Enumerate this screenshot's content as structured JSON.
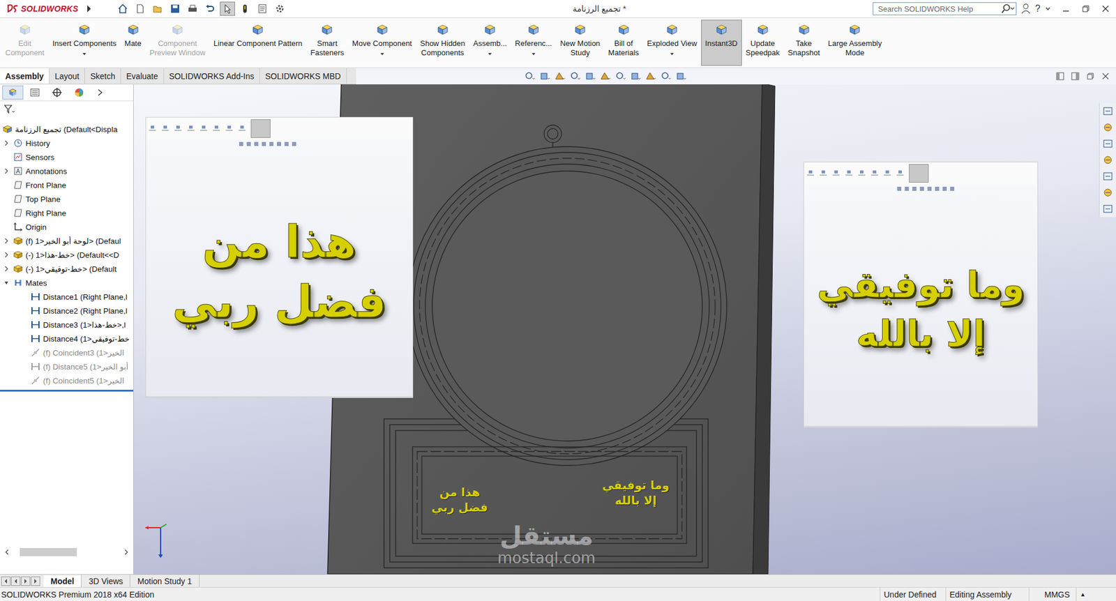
{
  "title_bar": {
    "logo": "SOLIDWORKS",
    "title": "تجميع الرزنامة *",
    "search": {
      "placeholder": "Search SOLIDWORKS Help"
    },
    "help": "?"
  },
  "ribbon": [
    {
      "lines": [
        "Edit",
        "Component"
      ],
      "disabled": true,
      "selected": false,
      "dropdown": false
    },
    {
      "lines": [
        "Insert Components"
      ],
      "disabled": false,
      "selected": false,
      "dropdown": true
    },
    {
      "lines": [
        "Mate"
      ],
      "disabled": false,
      "selected": false,
      "dropdown": false
    },
    {
      "lines": [
        "Component",
        "Preview Window"
      ],
      "disabled": true,
      "selected": false,
      "dropdown": false
    },
    {
      "lines": [
        "Linear Component Pattern"
      ],
      "disabled": false,
      "selected": false,
      "dropdown": false
    },
    {
      "lines": [
        "Smart",
        "Fasteners"
      ],
      "disabled": false,
      "selected": false,
      "dropdown": false
    },
    {
      "lines": [
        "Move Component"
      ],
      "disabled": false,
      "selected": false,
      "dropdown": true
    },
    {
      "lines": [
        "Show Hidden",
        "Components"
      ],
      "disabled": false,
      "selected": false,
      "dropdown": false
    },
    {
      "lines": [
        "Assemb..."
      ],
      "disabled": false,
      "selected": false,
      "dropdown": true
    },
    {
      "lines": [
        "Referenc..."
      ],
      "disabled": false,
      "selected": false,
      "dropdown": true
    },
    {
      "lines": [
        "New Motion",
        "Study"
      ],
      "disabled": false,
      "selected": false,
      "dropdown": false
    },
    {
      "lines": [
        "Bill of",
        "Materials"
      ],
      "disabled": false,
      "selected": false,
      "dropdown": false
    },
    {
      "lines": [
        "Exploded View"
      ],
      "disabled": false,
      "selected": false,
      "dropdown": true
    },
    {
      "lines": [
        "Instant3D"
      ],
      "disabled": false,
      "selected": true,
      "dropdown": false
    },
    {
      "lines": [
        "Update",
        "Speedpak"
      ],
      "disabled": false,
      "selected": false,
      "dropdown": false
    },
    {
      "lines": [
        "Take",
        "Snapshot"
      ],
      "disabled": false,
      "selected": false,
      "dropdown": false
    },
    {
      "lines": [
        "Large Assembly",
        "Mode"
      ],
      "disabled": false,
      "selected": false,
      "dropdown": false
    }
  ],
  "tabs": [
    {
      "label": "Assembly",
      "selected": true
    },
    {
      "label": "Layout",
      "selected": false
    },
    {
      "label": "Sketch",
      "selected": false
    },
    {
      "label": "Evaluate",
      "selected": false
    },
    {
      "label": "SOLIDWORKS Add-Ins",
      "selected": false
    },
    {
      "label": "SOLIDWORKS MBD",
      "selected": false
    }
  ],
  "feature_tree": {
    "items": [
      {
        "label": "تجميع الرزنامة  (Default<Displa",
        "kind": "assembly",
        "depth": 0,
        "expandable": false,
        "expanded": false,
        "dimmed": false
      },
      {
        "label": "History",
        "kind": "history",
        "depth": 1,
        "expandable": true,
        "expanded": false,
        "dimmed": false
      },
      {
        "label": "Sensors",
        "kind": "sensors",
        "depth": 1,
        "expandable": false,
        "expanded": false,
        "dimmed": false
      },
      {
        "label": "Annotations",
        "kind": "annotations",
        "depth": 1,
        "expandable": true,
        "expanded": false,
        "dimmed": false
      },
      {
        "label": "Front Plane",
        "kind": "plane",
        "depth": 1,
        "expandable": false,
        "expanded": false,
        "dimmed": false
      },
      {
        "label": "Top Plane",
        "kind": "plane",
        "depth": 1,
        "expandable": false,
        "expanded": false,
        "dimmed": false
      },
      {
        "label": "Right Plane",
        "kind": "plane",
        "depth": 1,
        "expandable": false,
        "expanded": false,
        "dimmed": false
      },
      {
        "label": "Origin",
        "kind": "origin",
        "depth": 1,
        "expandable": false,
        "expanded": false,
        "dimmed": false
      },
      {
        "label": "(f) لوحة أبو الخير<1> (Defaul",
        "kind": "part",
        "depth": 1,
        "expandable": true,
        "expanded": false,
        "dimmed": false
      },
      {
        "label": "(-) خط-هذا<1> (Default<<D",
        "kind": "part",
        "depth": 1,
        "expandable": true,
        "expanded": false,
        "dimmed": false
      },
      {
        "label": "(-) خط-توفيقي<1> (Default",
        "kind": "part",
        "depth": 1,
        "expandable": true,
        "expanded": false,
        "dimmed": false
      },
      {
        "label": "Mates",
        "kind": "mates",
        "depth": 1,
        "expandable": true,
        "expanded": true,
        "dimmed": false
      },
      {
        "label": "Distance1 (Right Plane,l",
        "kind": "distance",
        "depth": 2,
        "expandable": false,
        "expanded": false,
        "dimmed": false
      },
      {
        "label": "Distance2 (Right Plane,l",
        "kind": "distance",
        "depth": 2,
        "expandable": false,
        "expanded": false,
        "dimmed": false
      },
      {
        "label": "Distance3 (خط-هذا<1>,l",
        "kind": "distance",
        "depth": 2,
        "expandable": false,
        "expanded": false,
        "dimmed": false
      },
      {
        "label": "Distance4 (خط-توفيقي<1",
        "kind": "distance",
        "depth": 2,
        "expandable": false,
        "expanded": false,
        "dimmed": false
      },
      {
        "label": "(f) Coincident3 (الخير<1",
        "kind": "coincident",
        "depth": 2,
        "expandable": false,
        "expanded": false,
        "dimmed": true
      },
      {
        "label": "(f) Distance5 (أبو الخير<1",
        "kind": "distance",
        "depth": 2,
        "expandable": false,
        "expanded": false,
        "dimmed": true
      },
      {
        "label": "(f) Coincident5 (الخير<1",
        "kind": "coincident",
        "depth": 2,
        "expandable": false,
        "expanded": false,
        "dimmed": true
      }
    ]
  },
  "viewport": {
    "insets": [
      {
        "calligraphy": "هذا من فضل ربي"
      },
      {
        "calligraphy": "وما توفيقي إلا بالله"
      }
    ],
    "plate": {
      "labels": [
        "هذا من فضل ربي",
        "وما توفيقي إلا بالله"
      ]
    },
    "watermark": {
      "arabic": "مستقل",
      "latin": "mostaql.com"
    }
  },
  "bottom_tabs": [
    {
      "label": "Model",
      "selected": true
    },
    {
      "label": "3D Views",
      "selected": false
    },
    {
      "label": "Motion Study 1",
      "selected": false
    }
  ],
  "status_bar": {
    "edition": "SOLIDWORKS Premium 2018 x64 Edition",
    "fields": [
      "Under Defined",
      "Editing Assembly",
      "MMGS",
      "▲"
    ]
  }
}
